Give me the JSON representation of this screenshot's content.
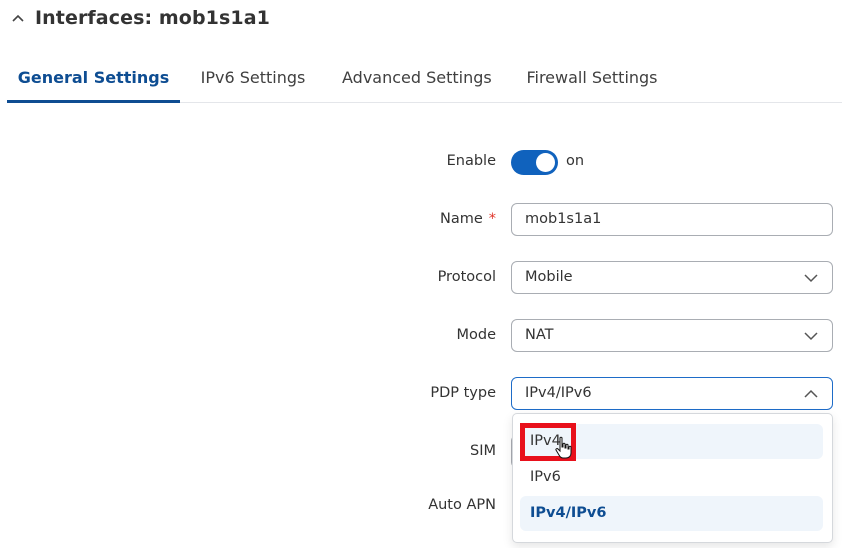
{
  "header": {
    "title": "Interfaces: mob1s1a1"
  },
  "tabs": [
    {
      "label": "General Settings",
      "active": true
    },
    {
      "label": "IPv6 Settings",
      "active": false
    },
    {
      "label": "Advanced Settings",
      "active": false
    },
    {
      "label": "Firewall Settings",
      "active": false
    }
  ],
  "form": {
    "enable": {
      "label": "Enable",
      "state": "on"
    },
    "name": {
      "label": "Name",
      "required_mark": "*",
      "value": "mob1s1a1"
    },
    "protocol": {
      "label": "Protocol",
      "value": "Mobile"
    },
    "mode": {
      "label": "Mode",
      "value": "NAT"
    },
    "pdp_type": {
      "label": "PDP type",
      "value": "IPv4/IPv6",
      "options": [
        "IPv4",
        "IPv6",
        "IPv4/IPv6"
      ],
      "hovered_option": "IPv4",
      "selected_option": "IPv4/IPv6"
    },
    "sim": {
      "label": "SIM"
    },
    "auto_apn": {
      "label": "Auto APN"
    }
  },
  "icons": {
    "collapse": "chevron-up-icon",
    "select_closed": "chevron-down-icon",
    "select_open": "chevron-up-icon",
    "pointer": "hand-pointer-icon"
  },
  "colors": {
    "accent": "#0e4d92",
    "toggle_on": "#1062bd",
    "required": "#e0352b",
    "annotation": "#e8101b",
    "option_highlight": "#eff5fb"
  }
}
